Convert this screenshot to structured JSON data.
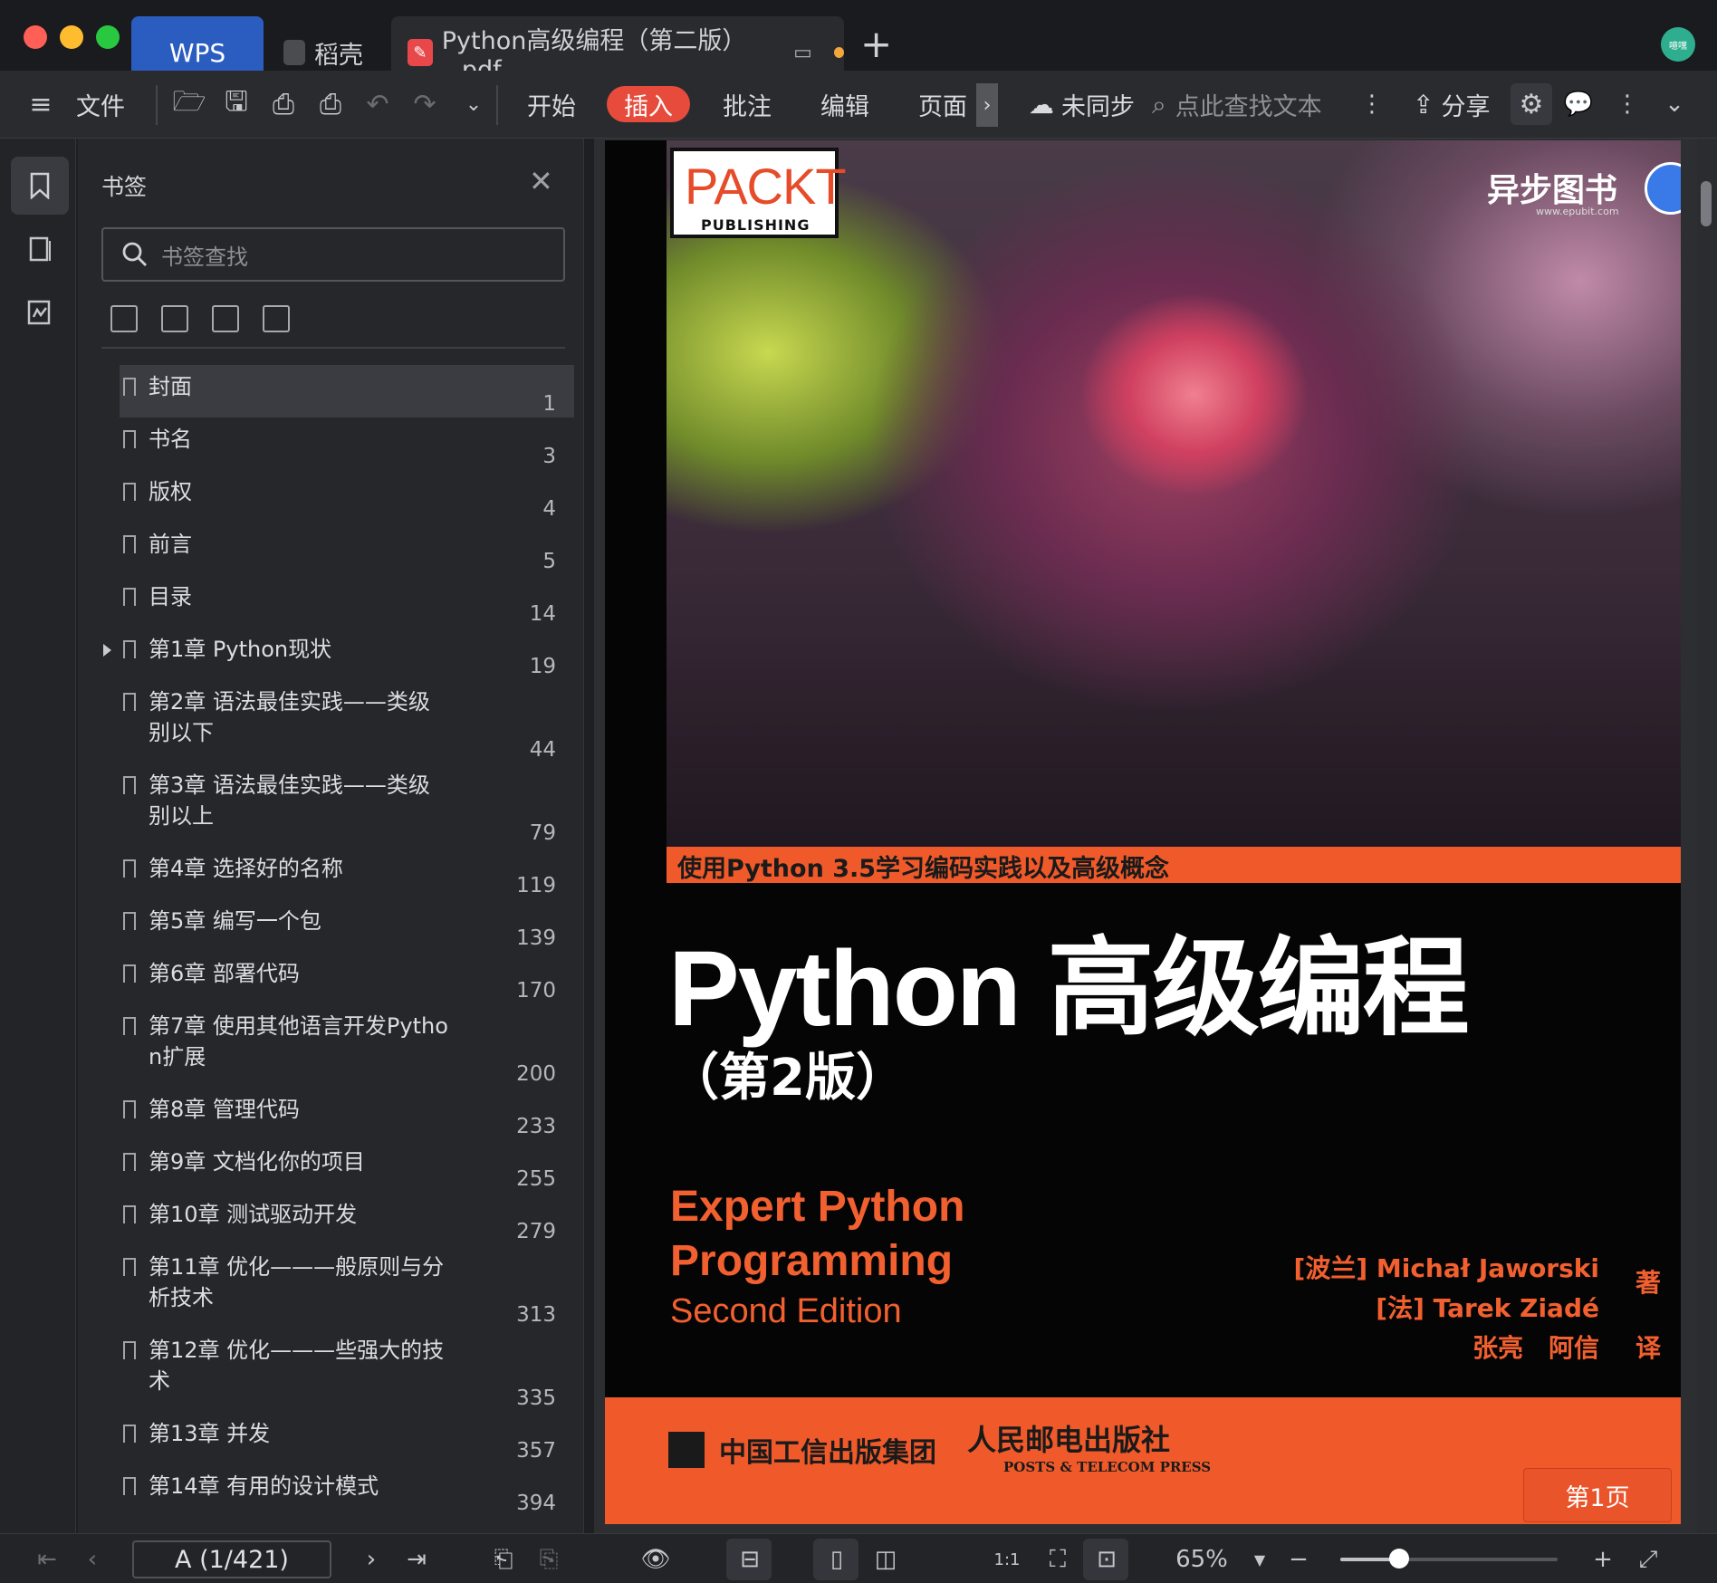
{
  "titlebar": {
    "tabs": [
      {
        "label": "WPS"
      },
      {
        "label": "稻壳"
      },
      {
        "label": "Python高级编程（第二版）_.pdf"
      }
    ],
    "avatar_text": "噫嘿"
  },
  "toolbar": {
    "file_label": "文件",
    "menus": [
      "开始",
      "插入",
      "批注",
      "编辑",
      "页面"
    ],
    "active_menu": "插入",
    "sync_label": "未同步",
    "search_placeholder": "点此查找文本",
    "share_label": "分享"
  },
  "bookmarks": {
    "title": "书签",
    "search_placeholder": "书签查找",
    "items": [
      {
        "label": "封面",
        "page": "1",
        "selected": true
      },
      {
        "label": "书名",
        "page": "3"
      },
      {
        "label": "版权",
        "page": "4"
      },
      {
        "label": "前言",
        "page": "5"
      },
      {
        "label": "目录",
        "page": "14"
      },
      {
        "label": "第1章 Python现状",
        "page": "19",
        "expandable": true
      },
      {
        "label": "第2章 语法最佳实践——类级\n别以下",
        "page": "44"
      },
      {
        "label": "第3章 语法最佳实践——类级\n别以上",
        "page": "79"
      },
      {
        "label": "第4章 选择好的名称",
        "page": "119"
      },
      {
        "label": "第5章 编写一个包",
        "page": "139"
      },
      {
        "label": "第6章 部署代码",
        "page": "170"
      },
      {
        "label": "第7章 使用其他语言开发Pytho\nn扩展",
        "page": "200"
      },
      {
        "label": "第8章 管理代码",
        "page": "233"
      },
      {
        "label": "第9章 文档化你的项目",
        "page": "255"
      },
      {
        "label": "第10章 测试驱动开发",
        "page": "279"
      },
      {
        "label": "第11章 优化———般原则与分\n析技术",
        "page": "313"
      },
      {
        "label": "第12章 优化———些强大的技\n术",
        "page": "335"
      },
      {
        "label": "第13章 并发",
        "page": "357"
      },
      {
        "label": "第14章 有用的设计模式",
        "page": "394"
      }
    ]
  },
  "cover": {
    "publisher_logo": "PACKT",
    "publisher_logo_sub": "PUBLISHING",
    "epubit_logo": "异步图书",
    "epubit_url": "www.epubit.com",
    "strip_text": "使用Python 3.5学习编码实践以及高级概念",
    "title_cn": "Python 高级编程",
    "edition_cn": "（第2版）",
    "title_en_line1": "Expert Python",
    "title_en_line2": "Programming",
    "title_en_line3": "Second Edition",
    "author1": "[波兰] Michał Jaworski",
    "author2": "[法] Tarek Ziadé",
    "author_verb": "著",
    "translators": "张亮　阿信",
    "translator_verb": "译",
    "publisher1": "中国工信出版集团",
    "publisher2_cn": "人民邮电出版社",
    "publisher2_en": "POSTS & TELECOM PRESS",
    "page_badge": "第1页"
  },
  "statusbar": {
    "page_indicator": "A (1/421)",
    "zoom": "65%",
    "zoom_fraction": 0.27
  },
  "colors": {
    "accent_blue": "#2b5dc0",
    "insert_red": "#e64b3c",
    "cover_orange": "#f05a2a"
  }
}
